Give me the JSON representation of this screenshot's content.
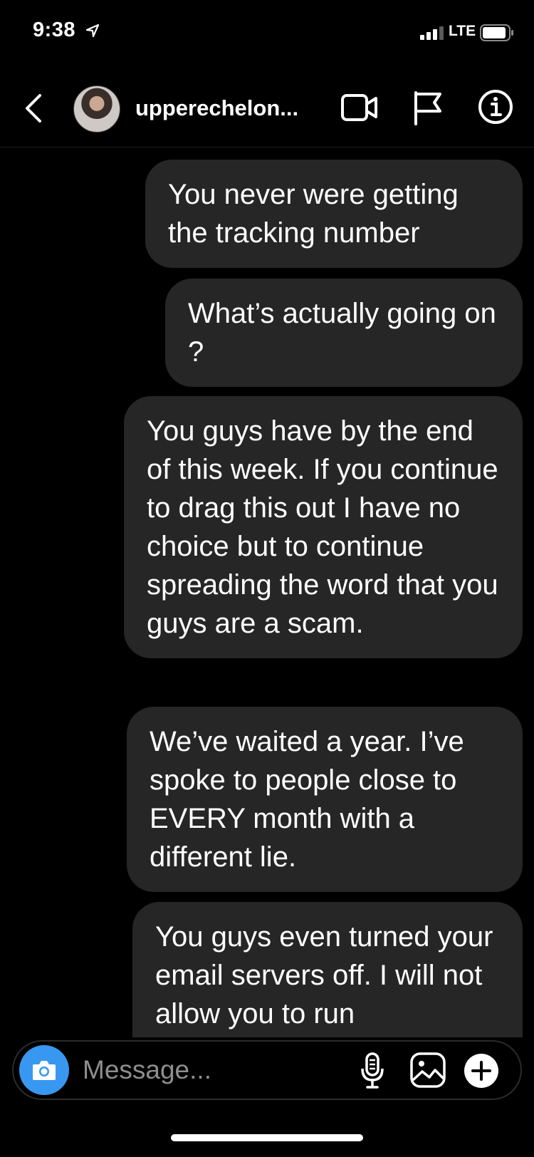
{
  "status_bar": {
    "time": "9:38",
    "network": "LTE"
  },
  "header": {
    "username": "upperechelon...",
    "icons": [
      "back-chevron-icon",
      "video-call-icon",
      "flag-icon",
      "info-icon"
    ]
  },
  "messages": [
    {
      "text": "You never were getting the tracking number",
      "sender": "me"
    },
    {
      "text": "What’s actually going on ?",
      "sender": "me"
    },
    {
      "text": "You guys have by the end of this week. If you continue to drag this out I have no choice but to continue spreading the word that you guys are a scam.",
      "sender": "me"
    },
    {
      "text": "We’ve waited a year. I’ve spoke to people close to EVERY month with a different lie.",
      "sender": "me"
    },
    {
      "text": "You guys even turned your email servers off. I will not allow you to run",
      "sender": "me"
    }
  ],
  "composer": {
    "placeholder": "Message...",
    "icons": [
      "camera-icon",
      "microphone-icon",
      "gallery-icon",
      "plus-icon"
    ]
  },
  "colors": {
    "background": "#000000",
    "bubble": "#262626",
    "camera_button": "#3897f0",
    "placeholder": "#8e8e8e"
  }
}
